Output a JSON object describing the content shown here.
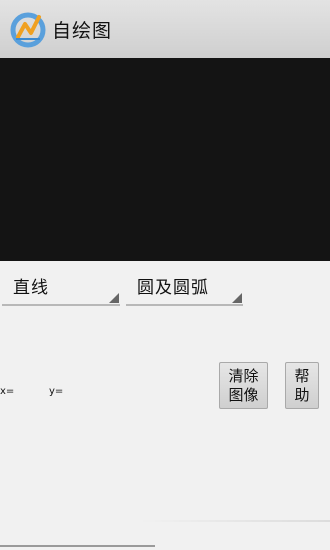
{
  "titlebar": {
    "title": "自绘图",
    "icon": "app-logo-icon"
  },
  "spinners": {
    "line_type": "直线",
    "circle_type": "圆及圆弧"
  },
  "coords": {
    "x_label": "x=",
    "y_label": "y="
  },
  "buttons": {
    "clear_line1": "清除",
    "clear_line2": "图像",
    "help_line1": "帮",
    "help_line2": "助"
  },
  "colors": {
    "canvas": "#141414",
    "titlebar": "#d8d8d8",
    "background": "#f1f1f1"
  }
}
